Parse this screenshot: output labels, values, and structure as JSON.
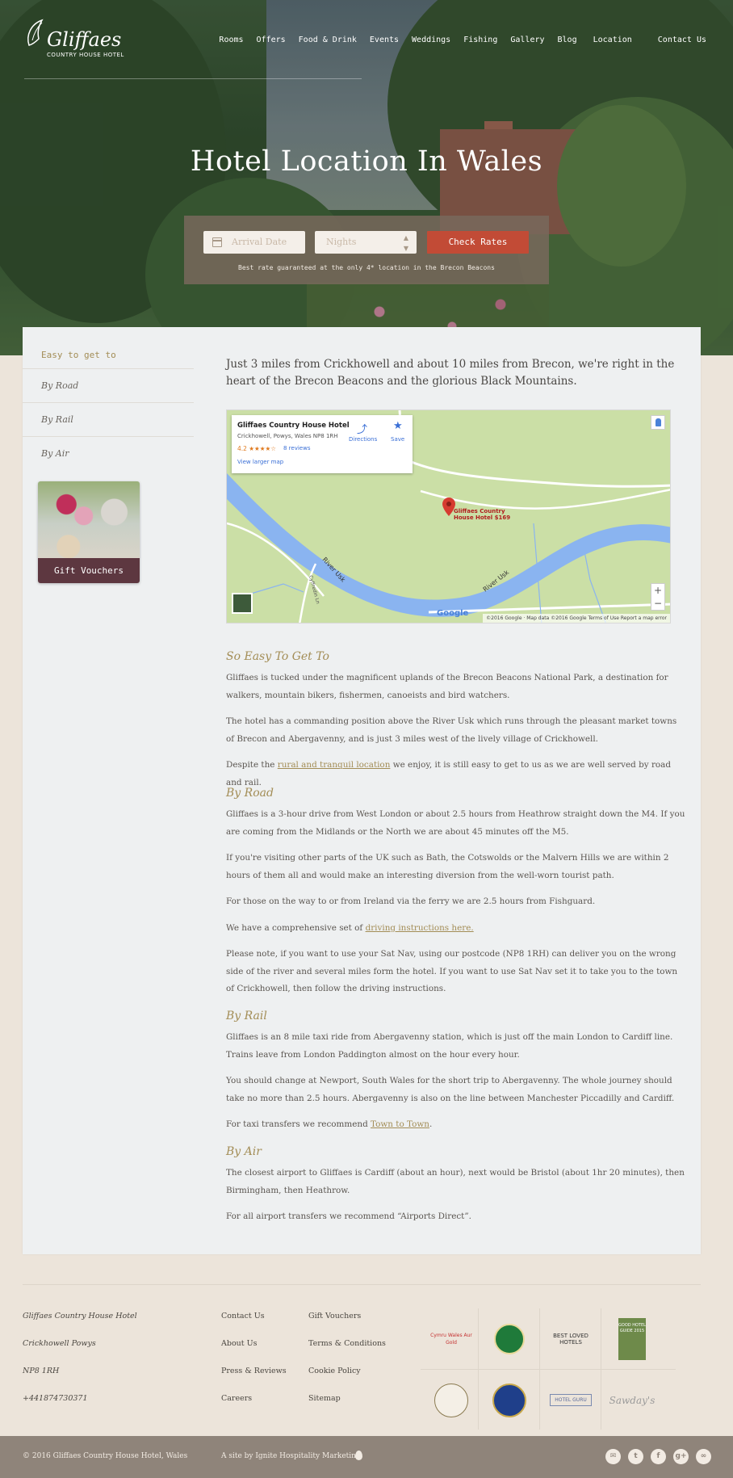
{
  "header": {
    "logo_name": "Gliffaes",
    "logo_sub": "COUNTRY HOUSE HOTEL",
    "nav": [
      "Rooms",
      "Offers",
      "Food & Drink",
      "Events",
      "Weddings",
      "Fishing",
      "Gallery",
      "Blog",
      "Location",
      "Contact Us"
    ]
  },
  "hero": {
    "title": "Hotel Location In Wales"
  },
  "booking": {
    "arrival_placeholder": "Arrival Date",
    "nights_placeholder": "Nights",
    "check_label": "Check Rates",
    "guarantee": "Best rate guaranteed at the only 4* location in the Brecon Beacons"
  },
  "sidebar": {
    "heading": "Easy to get to",
    "items": [
      "By Road",
      "By Rail",
      "By Air"
    ],
    "voucher_label": "Gift Vouchers"
  },
  "intro": "Just 3 miles from Crickhowell and about 10 miles from Brecon, we're right in the heart of the Brecon Beacons and the glorious Black Mountains.",
  "map": {
    "place_name": "Gliffaes Country House Hotel",
    "address": "Crickhowell, Powys, Wales NP8 1RH",
    "rating": "4.2 ★★★★☆",
    "reviews": "8 reviews",
    "larger_map": "View larger map",
    "directions": "Directions",
    "save": "Save",
    "pin_label": "Gliffaes Country House Hotel $169",
    "river_1": "River Usk",
    "river_2": "River Usk",
    "road": "Cyffredin Ln",
    "attribution": "©2016 Google · Map data ©2016 Google    Terms of Use    Report a map error",
    "google": "Google"
  },
  "sections": {
    "easy": {
      "title": "So Easy To Get To",
      "p1": "Gliffaes is tucked under the magnificent uplands of the Brecon Beacons National Park, a destination for walkers, mountain bikers, fishermen, canoeists and bird watchers.",
      "p2": "The hotel has a commanding position above the River Usk which runs through the pleasant market towns of Brecon and Abergavenny, and is just 3 miles west of the lively village of Crickhowell.",
      "p3_before": "Despite the ",
      "p3_link": "rural and tranquil location",
      "p3_after": " we enjoy, it is still easy to get to us as we are well served by road and rail."
    },
    "road": {
      "title": "By Road",
      "p1": "Gliffaes is a 3-hour drive from West London or about 2.5 hours from Heathrow straight down the M4. If you are coming from the Midlands or the North we are about 45 minutes off the M5.",
      "p2": "If you're visiting other parts of the UK such as Bath, the Cotswolds or the Malvern Hills we are within 2 hours of them all and would make an interesting diversion from the well-worn tourist path.",
      "p3": "For those on the way to or from Ireland via the ferry we are 2.5 hours from Fishguard.",
      "p4_before": "We have a comprehensive set of ",
      "p4_link": "driving instructions here.",
      "p5": "Please note, if you want to use your Sat Nav, using our postcode (NP8 1RH) can deliver you on the wrong side of the river and several miles form the hotel. If you want to use Sat Nav set it to take you to the town of Crickhowell, then follow the driving instructions."
    },
    "rail": {
      "title": "By Rail",
      "p1": "Gliffaes is an 8 mile taxi ride from Abergavenny station, which is just off the main London to Cardiff line. Trains leave from London Paddington almost on the hour every hour.",
      "p2": "You should change at Newport, South Wales for the short trip to Abergavenny. The whole journey should take no more than 2.5 hours. Abergavenny is also on the line between Manchester Piccadilly and Cardiff.",
      "p3_before": "For taxi transfers we recommend ",
      "p3_link": "Town to Town",
      "p3_after": "."
    },
    "air": {
      "title": "By Air",
      "p1": "The closest airport to Gliffaes is Cardiff (about an hour), next would be Bristol (about 1hr 20 minutes), then Birmingham, then Heathrow.",
      "p2": "For all airport transfers we recommend “Airports Direct”."
    }
  },
  "footer": {
    "address": [
      "Gliffaes Country House Hotel",
      "Crickhowell Powys",
      "NP8 1RH",
      "+441874730371"
    ],
    "links1": [
      "Contact Us",
      "About Us",
      "Press & Reviews",
      "Careers"
    ],
    "links2": [
      "Gift Vouchers",
      "Terms & Conditions",
      "Cookie Policy",
      "Sitemap"
    ],
    "badges": [
      "Cymru Wales Aur Gold",
      "Slow Food",
      "BEST LOVED HOTELS",
      "GOOD HOTEL GUIDE 2015",
      "Supporters' Scheme",
      "BRITAIN'S FINEST",
      "HOTEL GURU",
      "Sawday's"
    ],
    "copyright": "© 2016 Gliffaes Country House Hotel, Wales",
    "credit": "A site by Ignite Hospitality Marketing",
    "social": [
      "mail-icon",
      "twitter-icon",
      "facebook-icon",
      "googleplus-icon",
      "tripadvisor-icon"
    ]
  }
}
